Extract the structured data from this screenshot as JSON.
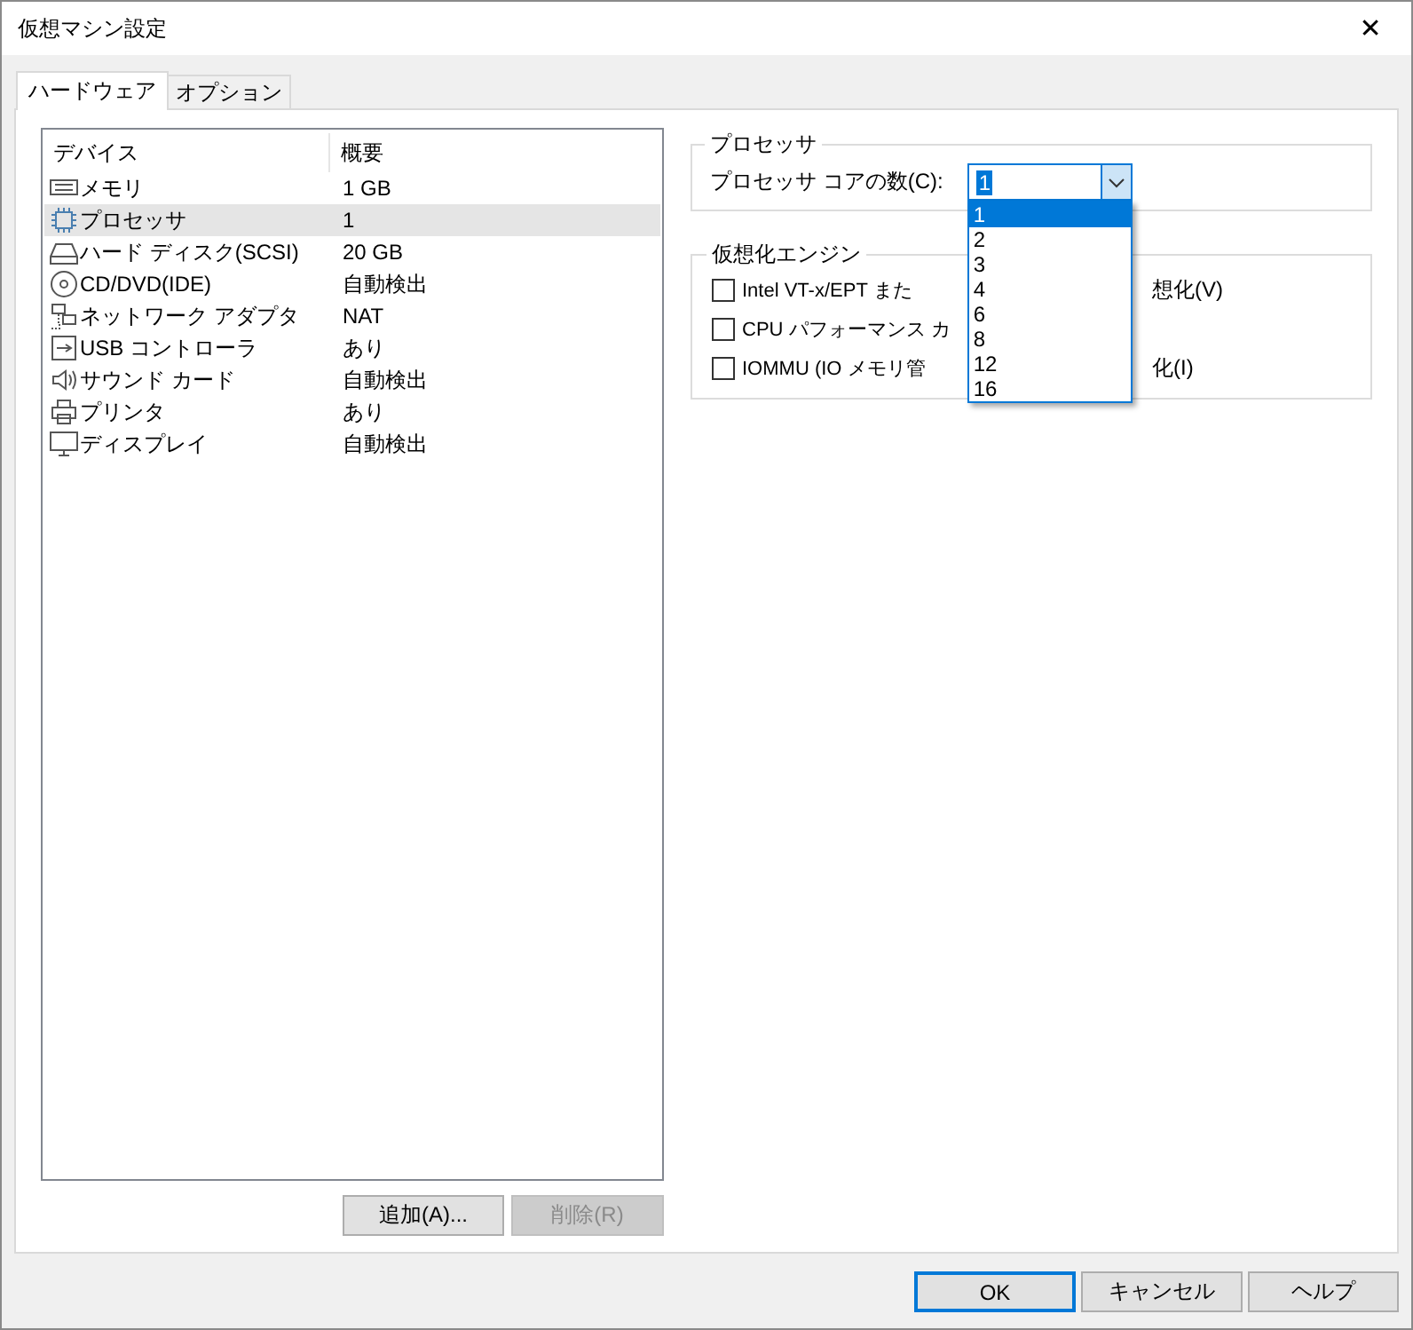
{
  "window": {
    "title": "仮想マシン設定",
    "close": "✕"
  },
  "tabs": [
    {
      "label": "ハードウェア",
      "selected": true
    },
    {
      "label": "オプション",
      "selected": false
    }
  ],
  "devices": {
    "columns": [
      "デバイス",
      "概要"
    ],
    "rows": [
      {
        "kind": "memory",
        "name": "メモリ",
        "summary": "1 GB",
        "selected": false
      },
      {
        "kind": "cpu",
        "name": "プロセッサ",
        "summary": "1",
        "selected": true
      },
      {
        "kind": "disk",
        "name": "ハード ディスク(SCSI)",
        "summary": "20 GB",
        "selected": false
      },
      {
        "kind": "cd",
        "name": "CD/DVD(IDE)",
        "summary": "自動検出",
        "selected": false
      },
      {
        "kind": "network",
        "name": "ネットワーク アダプタ",
        "summary": "NAT",
        "selected": false
      },
      {
        "kind": "usb",
        "name": "USB コントローラ",
        "summary": "あり",
        "selected": false
      },
      {
        "kind": "sound",
        "name": "サウンド カード",
        "summary": "自動検出",
        "selected": false
      },
      {
        "kind": "printer",
        "name": "プリンタ",
        "summary": "あり",
        "selected": false
      },
      {
        "kind": "display",
        "name": "ディスプレイ",
        "summary": "自動検出",
        "selected": false
      }
    ]
  },
  "list_buttons": [
    {
      "label": "追加(A)...",
      "disabled": false
    },
    {
      "label": "削除(R)",
      "disabled": true
    }
  ],
  "processor": {
    "title": "プロセッサ",
    "core_label": "プロセッサ コアの数(C):",
    "core_value": "1",
    "options": [
      {
        "label": "1",
        "selected": true
      },
      {
        "label": "2",
        "selected": false
      },
      {
        "label": "3",
        "selected": false
      },
      {
        "label": "4",
        "selected": false
      },
      {
        "label": "6",
        "selected": false
      },
      {
        "label": "8",
        "selected": false
      },
      {
        "label": "12",
        "selected": false
      },
      {
        "label": "16",
        "selected": false
      }
    ]
  },
  "virtualization": {
    "title": "仮想化エンジン",
    "options": [
      {
        "label_start": "Intel VT-x/EPT また",
        "label_end": "想化(V)",
        "checked": false
      },
      {
        "label_start": "CPU パフォーマンス カ",
        "checked": false
      },
      {
        "label_start": "IOMMU (IO メモリ管",
        "label_end": "化(I)",
        "checked": false
      }
    ]
  },
  "footer_buttons": [
    {
      "label": "OK",
      "default": true
    },
    {
      "label": "キャンセル",
      "default": false
    },
    {
      "label": "ヘルプ",
      "default": false
    }
  ]
}
